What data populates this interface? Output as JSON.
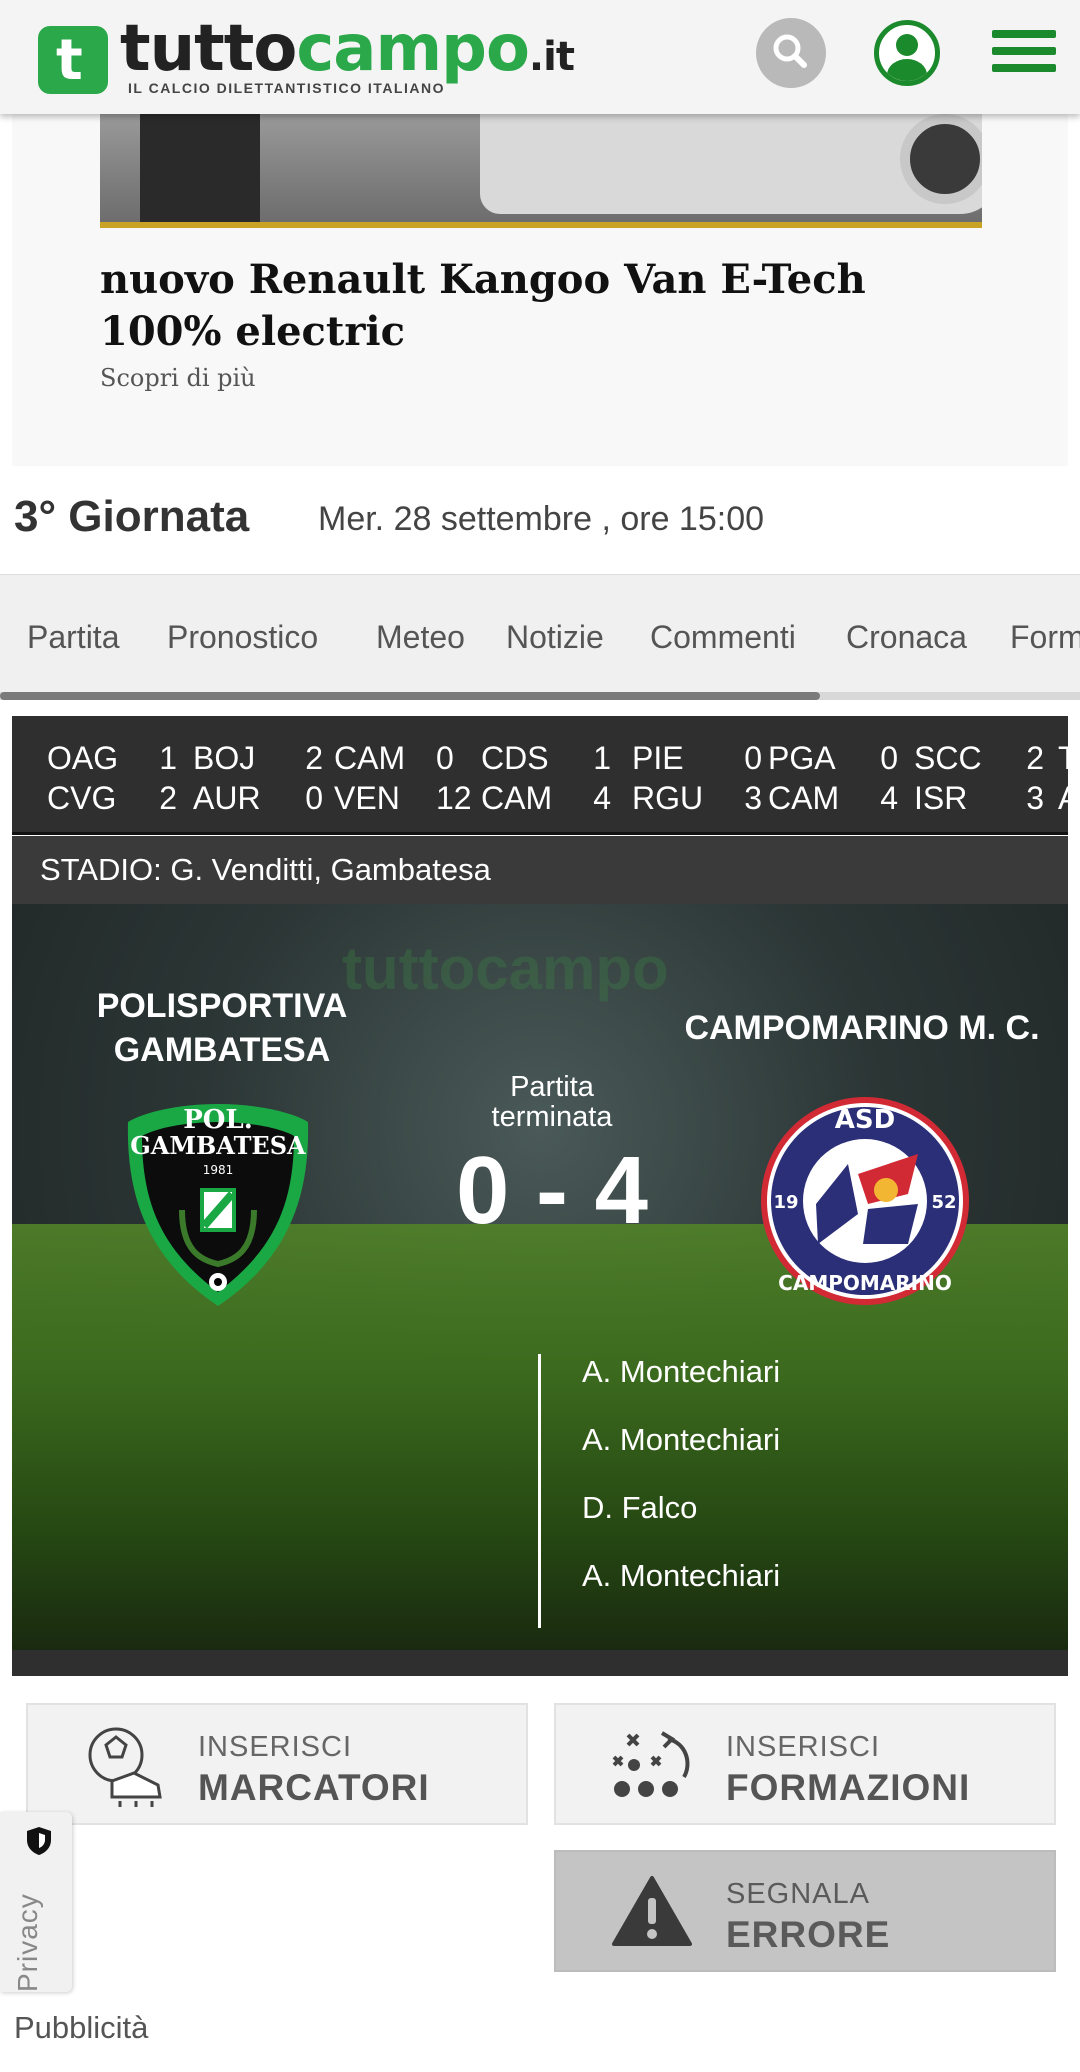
{
  "header": {
    "logo_main": "tutto",
    "logo_accent": "campo",
    "logo_suffix": ".it",
    "logo_tagline": "IL CALCIO DILETTANTISTICO ITALIANO",
    "brand_green": "#2aa84a"
  },
  "ad": {
    "title": "nuovo Renault Kangoo Van E-Tech 100% electric",
    "cta": "Scopri di più"
  },
  "round": {
    "title": "3° Giornata",
    "datetime": "Mer. 28 settembre , ore 15:00"
  },
  "tabs": [
    "Partita",
    "Pronostico",
    "Meteo",
    "Notizie",
    "Commenti",
    "Cronaca",
    "Form"
  ],
  "ticker": [
    {
      "home": "OAG",
      "home_score": "1",
      "away": "CVG",
      "away_score": "2"
    },
    {
      "home": "BOJ",
      "home_score": "2",
      "away": "AUR",
      "away_score": "0"
    },
    {
      "home": "CAM",
      "home_score": "0",
      "away": "VEN",
      "away_score": "12"
    },
    {
      "home": "CDS",
      "home_score": "1",
      "away": "CAM",
      "away_score": "4"
    },
    {
      "home": "PIE",
      "home_score": "0",
      "away": "RGU",
      "away_score": "3"
    },
    {
      "home": "PGA",
      "home_score": "0",
      "away": "CAM",
      "away_score": "4"
    },
    {
      "home": "SCC",
      "home_score": "2",
      "away": "ISR",
      "away_score": "3"
    },
    {
      "home": "T",
      "home_score": "",
      "away": "A",
      "away_score": ""
    }
  ],
  "stadium": "STADIO: G. Venditti, Gambatesa",
  "match": {
    "watermark": "tuttocampo",
    "home_team_line1": "POLISPORTIVA",
    "home_team_line2": "GAMBATESA",
    "away_team": "CAMPOMARINO M. C.",
    "status_line1": "Partita",
    "status_line2": "terminata",
    "score": "0 - 4",
    "home_crest_text1": "POL.",
    "home_crest_text2": "GAMBATESA",
    "home_crest_year": "1981",
    "away_crest_top": "ASD",
    "away_crest_bottom": "CAMPOMARINO",
    "away_crest_year_left": "19",
    "away_crest_year_right": "52",
    "away_scorers": [
      "A. Montechiari",
      "A. Montechiari",
      "D. Falco",
      "A. Montechiari"
    ]
  },
  "actions": {
    "scorers_l1": "INSERISCI",
    "scorers_l2": "MARCATORI",
    "lineups_l1": "INSERISCI",
    "lineups_l2": "FORMAZIONI",
    "error_l1": "SEGNALA",
    "error_l2": "ERRORE"
  },
  "privacy": "Privacy",
  "advertising_label": "Pubblicità"
}
